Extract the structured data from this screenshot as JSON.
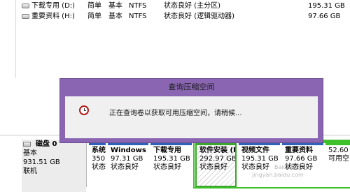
{
  "volumes": [
    {
      "name": "下载专用 (D:)",
      "layout": "简单",
      "type": "基本",
      "fs": "NTFS",
      "status": "状态良好 (主分区)",
      "capacity": "195.31 GB"
    },
    {
      "name": "重要资料 (H:)",
      "layout": "简单",
      "type": "基本",
      "fs": "NTFS",
      "status": "状态良好 (逻辑驱动器)",
      "capacity": "97.66 GB"
    }
  ],
  "dialog": {
    "title": "查询压缩空间",
    "message": "正在查询卷以获取可用压缩空间，请稍候..."
  },
  "disk": {
    "name": "磁盘 0",
    "type": "基本",
    "size": "931.51 GB",
    "state": "联机"
  },
  "partitions": [
    {
      "label": "系统",
      "size": "350",
      "status": "状态"
    },
    {
      "label": "Windows",
      "size": "97.31 GB",
      "status": "状态良好"
    },
    {
      "label": "下载专用",
      "size": "195.31 GB",
      "status": "状态良好"
    },
    {
      "label": "软件安装 (F:)",
      "size": "292.97 GB",
      "status": "状态良好"
    },
    {
      "label": "视频文件",
      "size": "195.31 GB",
      "status": "状态良好"
    },
    {
      "label": "重要资料",
      "size": "97.66 GB",
      "status": "状态良好"
    },
    {
      "label": "",
      "size": "52.60 G",
      "status": "可用空"
    }
  ],
  "watermark": {
    "line1": "jingyan.baidu.com",
    "line2": "Baidu经验"
  }
}
